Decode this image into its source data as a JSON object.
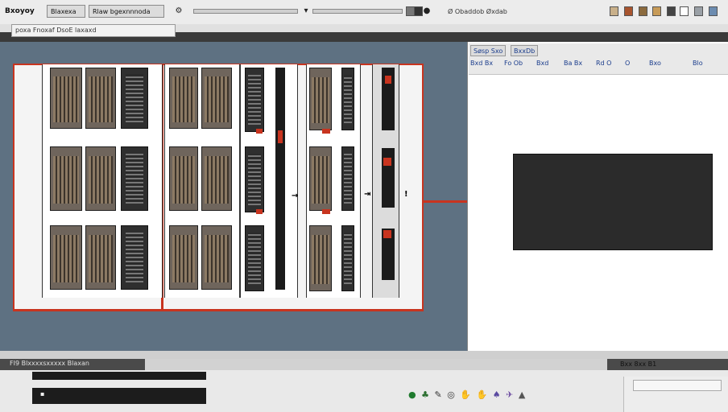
{
  "toolbar": {
    "title": "Bxoyoy",
    "buttons": [
      "Blaxexa",
      "Rlaw bgexnnnoda"
    ],
    "status": "Ø Obaddob Øxdab",
    "icons": [
      "circle-settings-icon",
      "dropdown-icon",
      "record-icon",
      "color-swatch-icon",
      "frame-icon",
      "box-icon",
      "page-icon",
      "circle-icon",
      "grid-icon",
      "layout-icon"
    ]
  },
  "subbar": {
    "field_value": "poxa Fnoxaf DsoE laxaxd"
  },
  "right_panel": {
    "tabs": [
      "Søsp Sxo",
      "BxxDb"
    ],
    "columns": [
      "Bxd Bx",
      "Fo Ob",
      "Bxd",
      "Ba Bx",
      "Rd O",
      "O",
      "Bxo",
      "Blo"
    ]
  },
  "bottom": {
    "left_label": "FI9 Blxxxxsxxxxx Blaxan",
    "right_label": "Bxx 8xx B1",
    "bar_label": "▪",
    "icon_glyphs": [
      "●",
      "♣",
      "✎",
      "◎",
      "✋",
      "✋",
      "♠",
      "✈",
      "▲"
    ]
  },
  "colors": {
    "canvas": "#5e7182",
    "frame_accent": "#c8341f",
    "preview_box": "#2b2b2b"
  }
}
